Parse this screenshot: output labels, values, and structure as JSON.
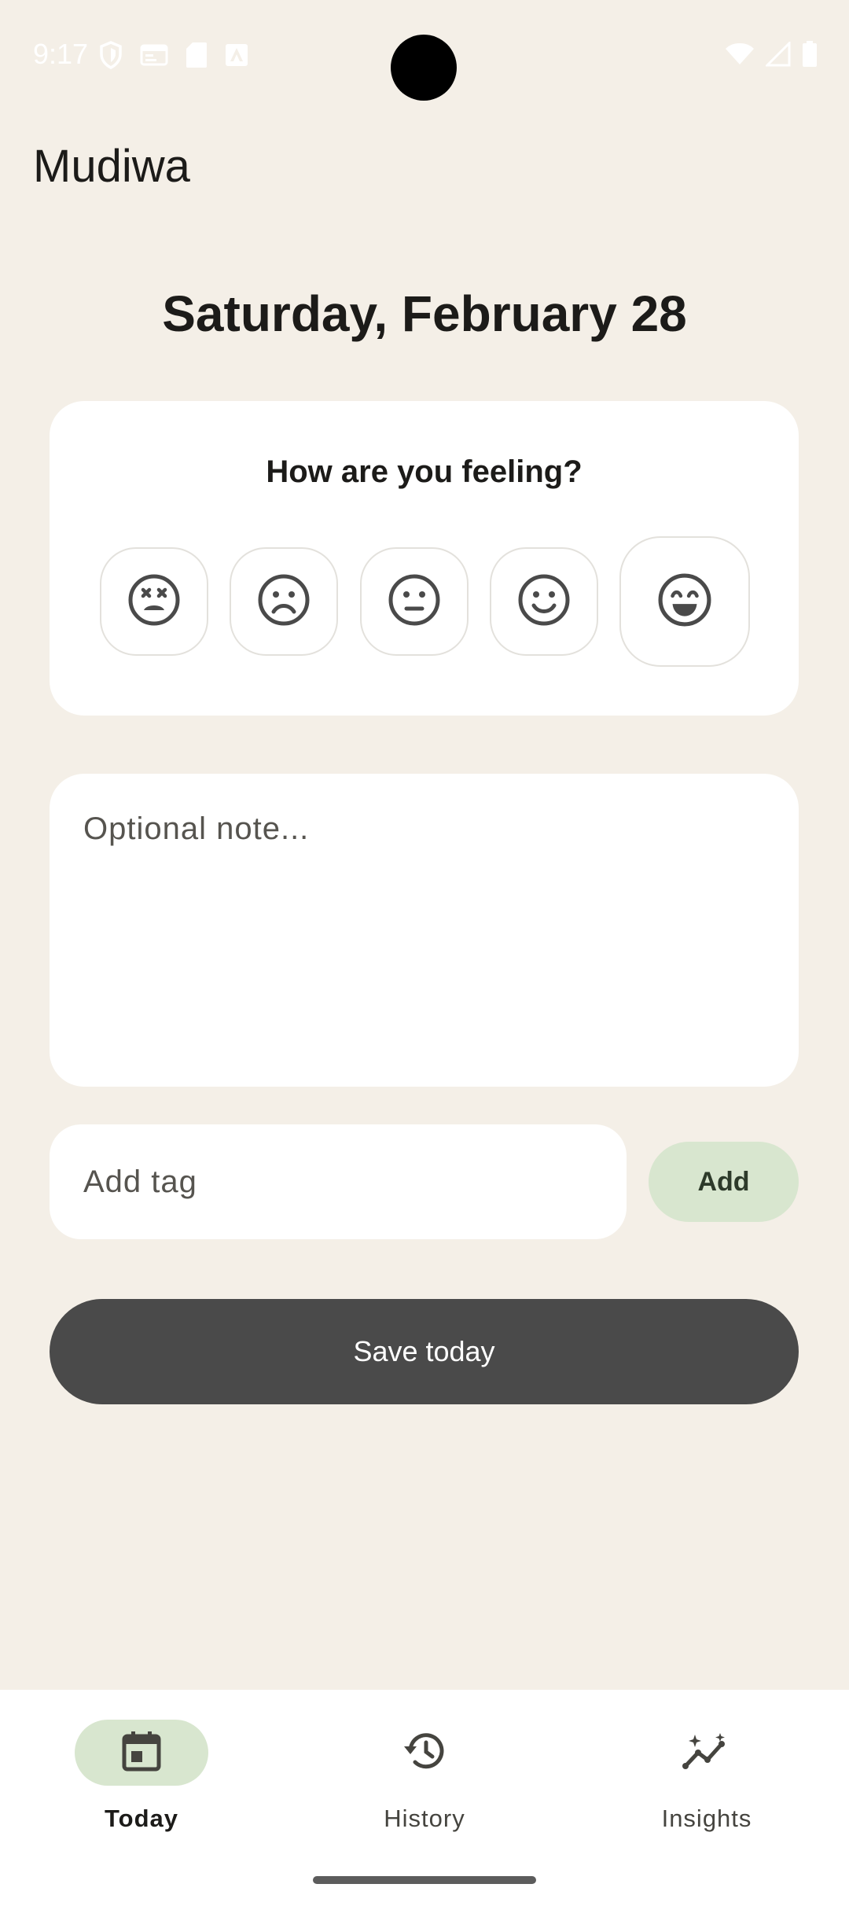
{
  "status_bar": {
    "time": "9:17",
    "left_icons": [
      "shield-icon",
      "browser-icon",
      "sd-card-icon",
      "app-store-icon"
    ],
    "right_icons": [
      "wifi-icon",
      "cell-signal-icon",
      "battery-icon"
    ]
  },
  "app": {
    "title": "Mudiwa"
  },
  "date_heading": "Saturday, February 28",
  "mood": {
    "question": "How are you feeling?",
    "options": [
      {
        "icon": "dizzy-face-icon"
      },
      {
        "icon": "sad-face-icon"
      },
      {
        "icon": "neutral-face-icon"
      },
      {
        "icon": "smile-face-icon"
      },
      {
        "icon": "grin-face-icon",
        "selected": true
      }
    ]
  },
  "note": {
    "placeholder": "Optional note...",
    "value": ""
  },
  "tag": {
    "placeholder": "Add tag",
    "value": "",
    "add_label": "Add"
  },
  "save_label": "Save today",
  "nav": {
    "items": [
      {
        "label": "Today",
        "icon": "calendar-icon",
        "active": true
      },
      {
        "label": "History",
        "icon": "history-icon",
        "active": false
      },
      {
        "label": "Insights",
        "icon": "insights-icon",
        "active": false
      }
    ]
  },
  "colors": {
    "background": "#f4efe7",
    "card": "#ffffff",
    "accent_green": "#d8e6cf",
    "save_button": "#4a4a4a"
  }
}
